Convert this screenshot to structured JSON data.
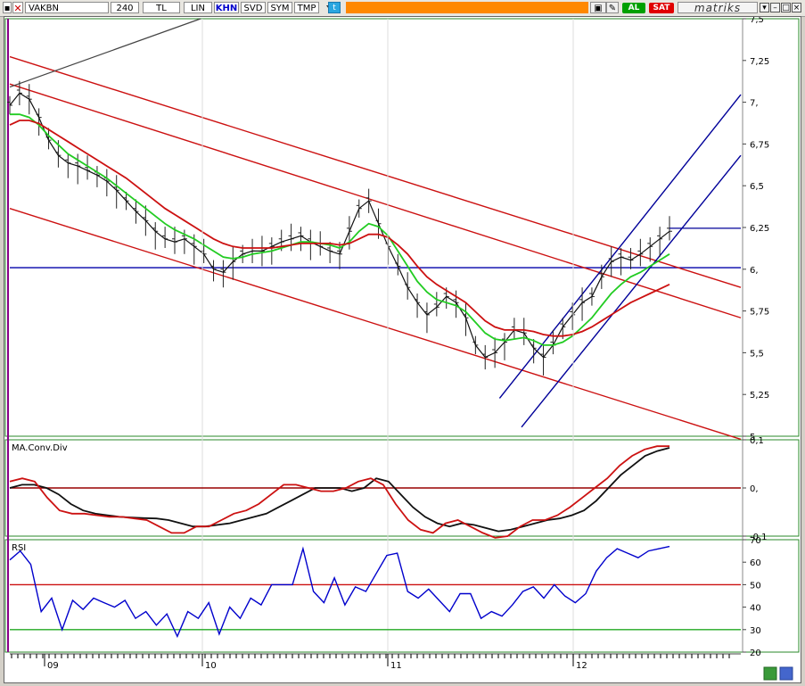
{
  "toolbar": {
    "symbol": "VAKBN",
    "period": "240",
    "currency": "TL",
    "scale_lin": "LIN",
    "khn": "KHN",
    "svd": "SVD",
    "sym": "SYM",
    "tmp": "TMP",
    "buy_label": "AL",
    "sell_label": "SAT",
    "brand": "matriks",
    "colors": {
      "orange": "#ff8800",
      "buy": "#00a000",
      "sell": "#e00000"
    }
  },
  "chart_data": [
    {
      "type": "line",
      "panel": "price",
      "yticks": [
        "7,5",
        "7,25",
        "7,",
        "6,75",
        "6,5",
        "6,25",
        "6,",
        "5,75",
        "5,5",
        "5,25",
        "5"
      ],
      "ylim": [
        5.0,
        7.75
      ],
      "x_ticks": [
        "09",
        "10",
        "11",
        "12"
      ],
      "horizontal_level": 6.11,
      "series": [
        {
          "color": "#111111",
          "values": [
            7.18,
            7.26,
            7.22,
            7.1,
            6.95,
            6.85,
            6.8,
            6.78,
            6.75,
            6.72,
            6.68,
            6.62,
            6.55,
            6.48,
            6.42,
            6.35,
            6.3,
            6.28,
            6.3,
            6.25,
            6.2,
            6.1,
            6.08,
            6.15,
            6.2,
            6.22,
            6.22,
            6.25,
            6.28,
            6.3,
            6.32,
            6.28,
            6.25,
            6.22,
            6.2,
            6.35,
            6.5,
            6.55,
            6.4,
            6.25,
            6.12,
            5.98,
            5.88,
            5.8,
            5.85,
            5.92,
            5.88,
            5.78,
            5.6,
            5.52,
            5.55,
            5.62,
            5.7,
            5.68,
            5.58,
            5.52,
            5.6,
            5.72,
            5.8,
            5.88,
            5.92,
            6.05,
            6.15,
            6.18,
            6.16,
            6.2,
            6.25,
            6.3,
            6.35
          ]
        },
        {
          "color": "#22cc22",
          "values": [
            7.12,
            7.12,
            7.1,
            7.05,
            6.98,
            6.92,
            6.86,
            6.82,
            6.78,
            6.74,
            6.7,
            6.65,
            6.6,
            6.55,
            6.5,
            6.45,
            6.4,
            6.36,
            6.33,
            6.3,
            6.26,
            6.22,
            6.18,
            6.17,
            6.18,
            6.2,
            6.21,
            6.22,
            6.24,
            6.26,
            6.28,
            6.28,
            6.27,
            6.26,
            6.24,
            6.28,
            6.35,
            6.4,
            6.38,
            6.32,
            6.22,
            6.12,
            6.02,
            5.95,
            5.9,
            5.88,
            5.86,
            5.82,
            5.75,
            5.68,
            5.64,
            5.63,
            5.64,
            5.65,
            5.63,
            5.6,
            5.6,
            5.62,
            5.66,
            5.72,
            5.78,
            5.86,
            5.94,
            6.0,
            6.05,
            6.08,
            6.12,
            6.16,
            6.2
          ]
        },
        {
          "color": "#cc1111",
          "values": [
            7.05,
            7.08,
            7.08,
            7.06,
            7.02,
            6.98,
            6.94,
            6.9,
            6.86,
            6.82,
            6.78,
            6.74,
            6.7,
            6.65,
            6.6,
            6.55,
            6.5,
            6.46,
            6.42,
            6.38,
            6.34,
            6.3,
            6.27,
            6.25,
            6.24,
            6.24,
            6.24,
            6.24,
            6.25,
            6.26,
            6.27,
            6.27,
            6.27,
            6.27,
            6.26,
            6.27,
            6.3,
            6.33,
            6.33,
            6.31,
            6.26,
            6.2,
            6.12,
            6.05,
            6.0,
            5.96,
            5.92,
            5.88,
            5.82,
            5.76,
            5.72,
            5.7,
            5.7,
            5.7,
            5.69,
            5.67,
            5.66,
            5.66,
            5.67,
            5.69,
            5.72,
            5.76,
            5.8,
            5.84,
            5.88,
            5.91,
            5.94,
            5.97,
            6.0
          ]
        }
      ],
      "trend_channels": [
        {
          "color": "#cc1111",
          "x": [
            0,
            1
          ],
          "y": [
            7.5,
            5.98
          ]
        },
        {
          "color": "#cc1111",
          "x": [
            0,
            1
          ],
          "y": [
            7.32,
            5.78
          ]
        },
        {
          "color": "#cc1111",
          "x": [
            0,
            1
          ],
          "y": [
            6.5,
            4.98
          ]
        },
        {
          "color": "#000099",
          "x": [
            0.67,
            1
          ],
          "y": [
            5.25,
            7.25
          ]
        },
        {
          "color": "#000099",
          "x": [
            0.7,
            1
          ],
          "y": [
            5.06,
            6.85
          ]
        }
      ]
    },
    {
      "type": "line",
      "panel": "macd",
      "label": "MA.Conv.Div",
      "yticks": [
        "0,1",
        "0,",
        "-0,1"
      ],
      "ylim": [
        -0.15,
        0.15
      ],
      "zero_line": 0,
      "series": [
        {
          "color": "#111111",
          "values": [
            0.0,
            0.01,
            0.01,
            0.0,
            -0.02,
            -0.05,
            -0.07,
            -0.08,
            -0.085,
            -0.09,
            -0.092,
            -0.094,
            -0.095,
            -0.1,
            -0.11,
            -0.12,
            -0.12,
            -0.115,
            -0.11,
            -0.1,
            -0.09,
            -0.08,
            -0.06,
            -0.04,
            -0.02,
            0.0,
            0.0,
            0.0,
            -0.01,
            0.0,
            0.03,
            0.02,
            -0.02,
            -0.06,
            -0.09,
            -0.11,
            -0.12,
            -0.11,
            -0.115,
            -0.125,
            -0.135,
            -0.13,
            -0.12,
            -0.11,
            -0.1,
            -0.095,
            -0.085,
            -0.07,
            -0.04,
            0.0,
            0.04,
            0.07,
            0.1,
            0.115,
            0.125
          ]
        },
        {
          "color": "#cc1111",
          "values": [
            0.02,
            0.03,
            0.02,
            -0.03,
            -0.07,
            -0.08,
            -0.08,
            -0.085,
            -0.09,
            -0.09,
            -0.095,
            -0.1,
            -0.12,
            -0.14,
            -0.14,
            -0.12,
            -0.12,
            -0.1,
            -0.08,
            -0.07,
            -0.05,
            -0.02,
            0.01,
            0.01,
            0.0,
            -0.01,
            -0.01,
            0.0,
            0.02,
            0.03,
            0.01,
            -0.05,
            -0.1,
            -0.13,
            -0.14,
            -0.11,
            -0.1,
            -0.12,
            -0.14,
            -0.155,
            -0.15,
            -0.12,
            -0.1,
            -0.1,
            -0.085,
            -0.06,
            -0.03,
            0.0,
            0.03,
            0.07,
            0.1,
            0.12,
            0.13,
            0.13
          ]
        }
      ]
    },
    {
      "type": "line",
      "panel": "rsi",
      "label": "RSI",
      "yticks": [
        "70",
        "60",
        "50",
        "40",
        "30",
        "20"
      ],
      "ylim": [
        20,
        70
      ],
      "levels": [
        {
          "value": 50,
          "color": "#cc1111"
        },
        {
          "value": 30,
          "color": "#22aa22"
        }
      ],
      "series": [
        {
          "color": "#0000cc",
          "values": [
            61,
            65,
            59,
            38,
            44,
            30,
            43,
            39,
            44,
            42,
            40,
            43,
            35,
            38,
            32,
            37,
            27,
            38,
            35,
            42,
            28,
            40,
            35,
            44,
            41,
            50,
            50,
            50,
            66,
            47,
            42,
            53,
            41,
            49,
            47,
            55,
            63,
            64,
            47,
            44,
            48,
            43,
            38,
            46,
            46,
            35,
            38,
            36,
            41,
            47,
            49,
            44,
            50,
            45,
            42,
            46,
            56,
            62,
            66,
            64,
            62,
            65,
            66,
            67
          ]
        }
      ]
    }
  ]
}
